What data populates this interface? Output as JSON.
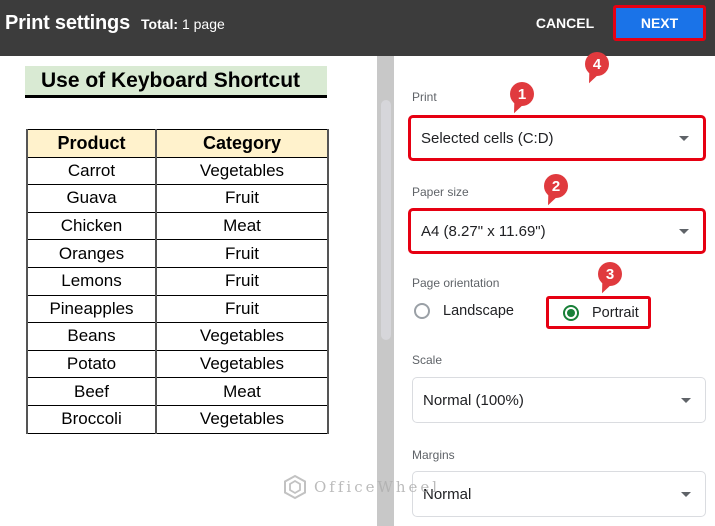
{
  "header": {
    "title": "Print settings",
    "total_label": "Total:",
    "total_value": "1 page",
    "cancel_label": "CANCEL",
    "next_label": "NEXT"
  },
  "preview": {
    "sheet_title": "Use of Keyboard Shortcut",
    "columns": [
      "Product",
      "Category"
    ],
    "rows": [
      [
        "Carrot",
        "Vegetables"
      ],
      [
        "Guava",
        "Fruit"
      ],
      [
        "Chicken",
        "Meat"
      ],
      [
        "Oranges",
        "Fruit"
      ],
      [
        "Lemons",
        "Fruit"
      ],
      [
        "Pineapples",
        "Fruit"
      ],
      [
        "Beans",
        "Vegetables"
      ],
      [
        "Potato",
        "Vegetables"
      ],
      [
        "Beef",
        "Meat"
      ],
      [
        "Broccoli",
        "Vegetables"
      ]
    ]
  },
  "settings": {
    "print": {
      "label": "Print",
      "value": "Selected cells (C:D)"
    },
    "paper_size": {
      "label": "Paper size",
      "value": "A4 (8.27\" x 11.69\")"
    },
    "orientation": {
      "label": "Page orientation",
      "options": [
        "Landscape",
        "Portrait"
      ],
      "selected": "Portrait"
    },
    "scale": {
      "label": "Scale",
      "value": "Normal (100%)"
    },
    "margins": {
      "label": "Margins",
      "value": "Normal"
    }
  },
  "annotations": [
    "1",
    "2",
    "3",
    "4"
  ],
  "watermark": "OfficeWheel",
  "colors": {
    "header_bg": "#3c3c3c",
    "accent": "#1a73e8",
    "highlight": "#e60012",
    "radio_selected": "#188038",
    "title_bg": "#d9ead3",
    "table_header_bg": "#fff2cc"
  }
}
